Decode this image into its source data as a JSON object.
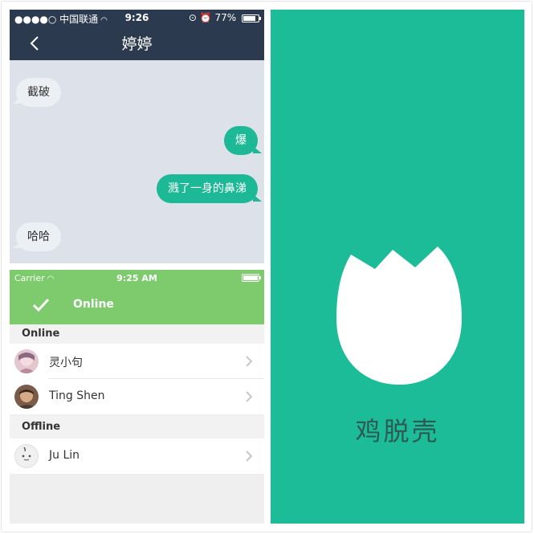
{
  "chat": {
    "status_bar": {
      "carrier": "●●●●○ 中国联通",
      "time": "9:26",
      "battery": "77%"
    },
    "title": "婷婷",
    "messages": [
      {
        "side": "in",
        "text": "截破"
      },
      {
        "side": "out",
        "text": "爆"
      },
      {
        "side": "out",
        "text": "溅了一身的鼻涕"
      },
      {
        "side": "in",
        "text": "哈哈"
      }
    ]
  },
  "status_screen": {
    "status_bar": {
      "carrier": "Carrier",
      "time": "9:25 AM"
    },
    "header_label": "Online",
    "sections": [
      {
        "title": "Online",
        "contacts": [
          {
            "name": "灵小句"
          },
          {
            "name": "Ting Shen"
          }
        ]
      },
      {
        "title": "Offline",
        "contacts": [
          {
            "name": "Ju Lin"
          }
        ]
      }
    ]
  },
  "splash": {
    "app_name": "鸡脱壳"
  },
  "colors": {
    "accent_teal": "#1dbc99",
    "nav_dark": "#2b3a4e",
    "online_green": "#7dcb6c",
    "chat_bg": "#dde1ea"
  }
}
